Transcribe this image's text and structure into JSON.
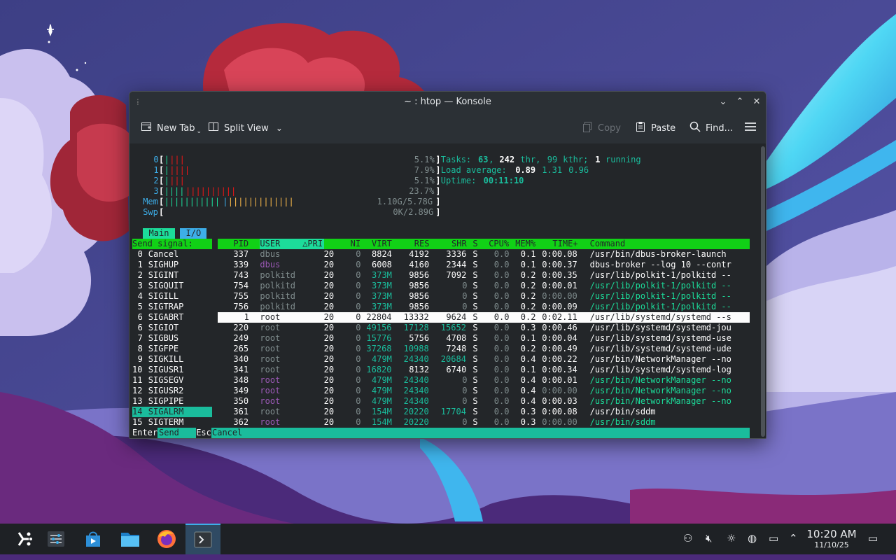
{
  "window": {
    "title": "~ : htop — Konsole",
    "title_icon": "konsole-small-icon"
  },
  "window_buttons": {
    "minimize": "⌄",
    "maximize": "⌃",
    "close": "✕"
  },
  "toolbar": {
    "new_tab": "New Tab",
    "split_view": "Split View",
    "copy": "Copy",
    "paste": "Paste",
    "find": "Find...",
    "menu_icon": "hamburger-menu-icon"
  },
  "htop": {
    "cpu_meters": [
      {
        "label": "0",
        "value": "5.1%",
        "green": 1,
        "red": 3
      },
      {
        "label": "1",
        "value": "7.9%",
        "green": 1,
        "red": 4
      },
      {
        "label": "2",
        "value": "5.1%",
        "green": 1,
        "red": 3
      },
      {
        "label": "3",
        "value": "23.7%",
        "green": 4,
        "red": 10
      }
    ],
    "mem": {
      "label": "Mem",
      "value": "1.10G/5.78G"
    },
    "swp": {
      "label": "Swp",
      "value": "0K/2.89G"
    },
    "tasks": {
      "prefix": "Tasks: ",
      "tasks": "63",
      "sep1": ", ",
      "thr": "242",
      "thr_label": " thr, ",
      "kthr": "99",
      "kthr_label": " kthr; ",
      "running": "1",
      "running_label": " running"
    },
    "load": {
      "label": "Load average: ",
      "one": "0.89",
      "five": "1.31",
      "fifteen": "0.96"
    },
    "uptime": {
      "label": "Uptime: ",
      "value": "00:11:10"
    },
    "tabs": {
      "main": "Main",
      "io": "I/O"
    },
    "signal_header": "Send signal:",
    "columns": {
      "pid": "PID",
      "user": "USER",
      "pri": "△PRI",
      "ni": "NI",
      "virt": "VIRT",
      "res": "RES",
      "shr": "SHR",
      "s": "S",
      "cpu": "CPU%",
      "mem": "MEM%",
      "time": "TIME+",
      "command": "Command"
    },
    "signals": [
      {
        "num": "0",
        "name": "Cancel"
      },
      {
        "num": "1",
        "name": "SIGHUP"
      },
      {
        "num": "2",
        "name": "SIGINT"
      },
      {
        "num": "3",
        "name": "SIGQUIT"
      },
      {
        "num": "4",
        "name": "SIGILL"
      },
      {
        "num": "5",
        "name": "SIGTRAP"
      },
      {
        "num": "6",
        "name": "SIGABRT"
      },
      {
        "num": "6",
        "name": "SIGIOT"
      },
      {
        "num": "7",
        "name": "SIGBUS"
      },
      {
        "num": "8",
        "name": "SIGFPE"
      },
      {
        "num": "9",
        "name": "SIGKILL"
      },
      {
        "num": "10",
        "name": "SIGUSR1"
      },
      {
        "num": "11",
        "name": "SIGSEGV"
      },
      {
        "num": "12",
        "name": "SIGUSR2"
      },
      {
        "num": "13",
        "name": "SIGPIPE"
      },
      {
        "num": "14",
        "name": "SIGALRM"
      },
      {
        "num": "15",
        "name": "SIGTERM"
      }
    ],
    "selected_signal": 15,
    "processes": [
      {
        "pid": "337",
        "user": "dbus",
        "pri": "20",
        "ni": "0",
        "virt": "8824",
        "res": "4192",
        "shr": "3336",
        "s": "S",
        "cpu": "0.0",
        "mem": "0.1",
        "time": "0:00.08",
        "command": "/usr/bin/dbus-broker-launch",
        "thread": false,
        "dim_user": false
      },
      {
        "pid": "339",
        "user": "dbus",
        "pri": "20",
        "ni": "0",
        "virt": "6008",
        "res": "4160",
        "shr": "2344",
        "s": "S",
        "cpu": "0.0",
        "mem": "0.1",
        "time": "0:00.37",
        "command": "dbus-broker --log 10 --contr",
        "thread": false,
        "dim_user": true
      },
      {
        "pid": "743",
        "user": "polkitd",
        "pri": "20",
        "ni": "0",
        "virt": "373M",
        "res": "9856",
        "shr": "7092",
        "s": "S",
        "cpu": "0.0",
        "mem": "0.2",
        "time": "0:00.35",
        "command": "/usr/lib/polkit-1/polkitd --",
        "thread": false,
        "dim_user": false
      },
      {
        "pid": "754",
        "user": "polkitd",
        "pri": "20",
        "ni": "0",
        "virt": "373M",
        "res": "9856",
        "shr": "0",
        "s": "S",
        "cpu": "0.0",
        "mem": "0.2",
        "time": "0:00.01",
        "command": "/usr/lib/polkit-1/polkitd --",
        "thread": true,
        "dim_user": false
      },
      {
        "pid": "755",
        "user": "polkitd",
        "pri": "20",
        "ni": "0",
        "virt": "373M",
        "res": "9856",
        "shr": "0",
        "s": "S",
        "cpu": "0.0",
        "mem": "0.2",
        "time": "0:00.00",
        "command": "/usr/lib/polkit-1/polkitd --",
        "thread": true,
        "dim_user": false
      },
      {
        "pid": "756",
        "user": "polkitd",
        "pri": "20",
        "ni": "0",
        "virt": "373M",
        "res": "9856",
        "shr": "0",
        "s": "S",
        "cpu": "0.0",
        "mem": "0.2",
        "time": "0:00.09",
        "command": "/usr/lib/polkit-1/polkitd --",
        "thread": true,
        "dim_user": false
      },
      {
        "pid": "1",
        "user": "root",
        "pri": "20",
        "ni": "0",
        "virt": "22804",
        "res": "13332",
        "shr": "9624",
        "s": "S",
        "cpu": "0.0",
        "mem": "0.2",
        "time": "0:02.11",
        "command": "/usr/lib/systemd/systemd --s",
        "thread": false,
        "dim_user": false
      },
      {
        "pid": "220",
        "user": "root",
        "pri": "20",
        "ni": "0",
        "virt": "49156",
        "res": "17128",
        "shr": "15652",
        "s": "S",
        "cpu": "0.0",
        "mem": "0.3",
        "time": "0:00.46",
        "command": "/usr/lib/systemd/systemd-jou",
        "thread": false,
        "dim_user": false
      },
      {
        "pid": "249",
        "user": "root",
        "pri": "20",
        "ni": "0",
        "virt": "15776",
        "res": "5756",
        "shr": "4708",
        "s": "S",
        "cpu": "0.0",
        "mem": "0.1",
        "time": "0:00.04",
        "command": "/usr/lib/systemd/systemd-use",
        "thread": false,
        "dim_user": false
      },
      {
        "pid": "265",
        "user": "root",
        "pri": "20",
        "ni": "0",
        "virt": "37268",
        "res": "10988",
        "shr": "7248",
        "s": "S",
        "cpu": "0.0",
        "mem": "0.2",
        "time": "0:00.49",
        "command": "/usr/lib/systemd/systemd-ude",
        "thread": false,
        "dim_user": false
      },
      {
        "pid": "340",
        "user": "root",
        "pri": "20",
        "ni": "0",
        "virt": "479M",
        "res": "24340",
        "shr": "20684",
        "s": "S",
        "cpu": "0.0",
        "mem": "0.4",
        "time": "0:00.22",
        "command": "/usr/bin/NetworkManager --no",
        "thread": false,
        "dim_user": false
      },
      {
        "pid": "341",
        "user": "root",
        "pri": "20",
        "ni": "0",
        "virt": "16820",
        "res": "8132",
        "shr": "6740",
        "s": "S",
        "cpu": "0.0",
        "mem": "0.1",
        "time": "0:00.34",
        "command": "/usr/lib/systemd/systemd-log",
        "thread": false,
        "dim_user": false
      },
      {
        "pid": "348",
        "user": "root",
        "pri": "20",
        "ni": "0",
        "virt": "479M",
        "res": "24340",
        "shr": "0",
        "s": "S",
        "cpu": "0.0",
        "mem": "0.4",
        "time": "0:00.01",
        "command": "/usr/bin/NetworkManager --no",
        "thread": true,
        "dim_user": true
      },
      {
        "pid": "349",
        "user": "root",
        "pri": "20",
        "ni": "0",
        "virt": "479M",
        "res": "24340",
        "shr": "0",
        "s": "S",
        "cpu": "0.0",
        "mem": "0.4",
        "time": "0:00.00",
        "command": "/usr/bin/NetworkManager --no",
        "thread": true,
        "dim_user": true
      },
      {
        "pid": "350",
        "user": "root",
        "pri": "20",
        "ni": "0",
        "virt": "479M",
        "res": "24340",
        "shr": "0",
        "s": "S",
        "cpu": "0.0",
        "mem": "0.4",
        "time": "0:00.03",
        "command": "/usr/bin/NetworkManager --no",
        "thread": true,
        "dim_user": true
      },
      {
        "pid": "361",
        "user": "root",
        "pri": "20",
        "ni": "0",
        "virt": "154M",
        "res": "20220",
        "shr": "17704",
        "s": "S",
        "cpu": "0.0",
        "mem": "0.3",
        "time": "0:00.08",
        "command": "/usr/bin/sddm",
        "thread": false,
        "dim_user": false
      },
      {
        "pid": "362",
        "user": "root",
        "pri": "20",
        "ni": "0",
        "virt": "154M",
        "res": "20220",
        "shr": "0",
        "s": "S",
        "cpu": "0.0",
        "mem": "0.3",
        "time": "0:00.00",
        "command": "/usr/bin/sddm",
        "thread": true,
        "dim_user": true
      }
    ],
    "selected_process": 6,
    "footer": {
      "enter_key": "Enter",
      "enter_label": "Send",
      "esc_key": "Esc",
      "esc_label": "Cancel"
    }
  },
  "taskbar": {
    "apps": [
      {
        "name": "application-launcher-icon"
      },
      {
        "name": "system-settings-icon"
      },
      {
        "name": "discover-store-icon"
      },
      {
        "name": "dolphin-file-manager-icon"
      },
      {
        "name": "firefox-icon"
      },
      {
        "name": "konsole-icon"
      }
    ],
    "tray": [
      "network-sharing-icon",
      "volume-muted-icon",
      "brightness-icon",
      "network-globe-icon",
      "display-icon",
      "show-hidden-arrow-icon"
    ],
    "clock": {
      "time": "10:20 AM",
      "date": "11/10/25"
    },
    "show_desktop": "show-desktop-icon"
  }
}
